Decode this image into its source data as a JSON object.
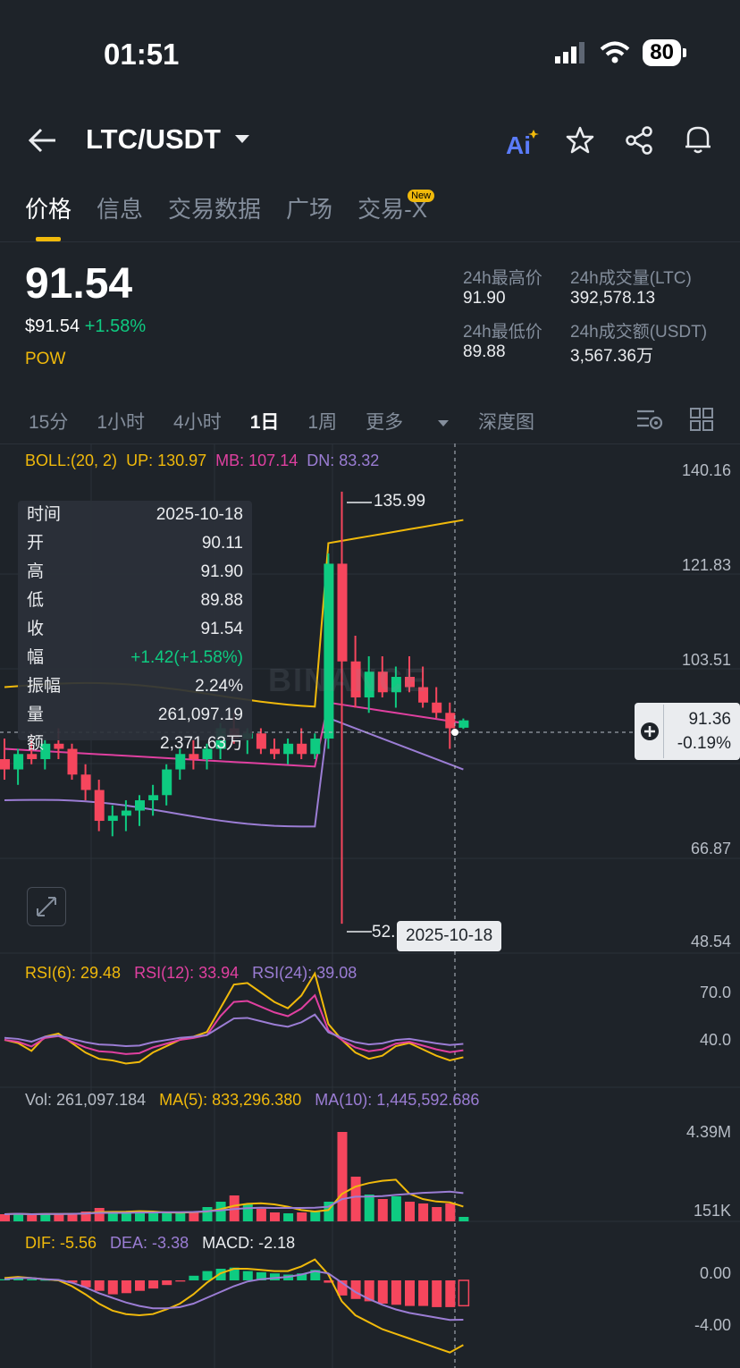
{
  "status": {
    "time": "01:51",
    "battery": "80"
  },
  "header": {
    "pair": "LTC/USDT"
  },
  "tabs": [
    {
      "label": "价格"
    },
    {
      "label": "信息"
    },
    {
      "label": "交易数据"
    },
    {
      "label": "广场"
    },
    {
      "label": "交易-X"
    }
  ],
  "new_badge": "New",
  "price": {
    "last": "91.54",
    "usd": "$91.54",
    "change": "+1.58%",
    "tag": "POW"
  },
  "stats": {
    "high_label": "24h最高价",
    "high_value": "91.90",
    "low_label": "24h最低价",
    "low_value": "89.88",
    "vol_label": "24h成交量(LTC)",
    "vol_value": "392,578.13",
    "amt_label": "24h成交额(USDT)",
    "amt_value": "3,567.36万"
  },
  "intervals": [
    "15分",
    "1小时",
    "4小时",
    "1日",
    "1周",
    "更多"
  ],
  "depth": "深度图",
  "boll": {
    "label": "BOLL:(20, 2)",
    "up": "UP: 130.97",
    "mb": "MB: 107.14",
    "dn": "DN: 83.32"
  },
  "price_axis": [
    "140.16",
    "121.83",
    "103.51",
    "66.87",
    "48.54"
  ],
  "max_label": "135.99",
  "min_label": "52.",
  "tooltip": [
    {
      "k": "时间",
      "v": "2025-10-18"
    },
    {
      "k": "开",
      "v": "90.11"
    },
    {
      "k": "高",
      "v": "91.90"
    },
    {
      "k": "低",
      "v": "89.88"
    },
    {
      "k": "收",
      "v": "91.54"
    },
    {
      "k": "幅",
      "v": "+1.42(+1.58%)"
    },
    {
      "k": "振幅",
      "v": "2.24%"
    },
    {
      "k": "量",
      "v": "261,097.19"
    },
    {
      "k": "额",
      "v": "2,371.63万"
    }
  ],
  "crosshair": {
    "price": "91.36",
    "pct": "-0.19%",
    "date": "2025-10-18"
  },
  "watermark": "BINANCE",
  "rsi": {
    "r6": "RSI(6): 29.48",
    "r12": "RSI(12): 33.94",
    "r24": "RSI(24): 39.08",
    "axis_hi": "70.0",
    "axis_lo": "40.0"
  },
  "vol": {
    "v": "Vol: 261,097.184",
    "ma5": "MA(5): 833,296.380",
    "ma10": "MA(10): 1,445,592.686",
    "axis_hi": "4.39M",
    "axis_lo": "151K"
  },
  "macd": {
    "dif": "DIF: -5.56",
    "dea": "DEA: -3.38",
    "macd": "MACD: -2.18",
    "axis_hi": "0.00",
    "axis_lo": "-4.00"
  },
  "colors": {
    "up": "#0ecb81",
    "down": "#f6465d",
    "accent": "#f0b90b",
    "mb": "#e040a0",
    "dn": "#9b7dd4"
  },
  "chart_data": {
    "type": "candlestick",
    "candles": [
      {
        "o": 84,
        "h": 88,
        "l": 80,
        "c": 82
      },
      {
        "o": 82,
        "h": 86,
        "l": 79,
        "c": 85
      },
      {
        "o": 85,
        "h": 89,
        "l": 83,
        "c": 84
      },
      {
        "o": 84,
        "h": 88,
        "l": 82,
        "c": 87
      },
      {
        "o": 87,
        "h": 90,
        "l": 84,
        "c": 86
      },
      {
        "o": 86,
        "h": 87,
        "l": 80,
        "c": 81
      },
      {
        "o": 81,
        "h": 83,
        "l": 76,
        "c": 78
      },
      {
        "o": 78,
        "h": 80,
        "l": 70,
        "c": 72
      },
      {
        "o": 72,
        "h": 75,
        "l": 69,
        "c": 73
      },
      {
        "o": 73,
        "h": 76,
        "l": 70,
        "c": 74
      },
      {
        "o": 74,
        "h": 77,
        "l": 71,
        "c": 76
      },
      {
        "o": 76,
        "h": 79,
        "l": 73,
        "c": 77
      },
      {
        "o": 77,
        "h": 83,
        "l": 75,
        "c": 82
      },
      {
        "o": 82,
        "h": 86,
        "l": 80,
        "c": 85
      },
      {
        "o": 85,
        "h": 88,
        "l": 82,
        "c": 84
      },
      {
        "o": 84,
        "h": 87,
        "l": 82,
        "c": 86
      },
      {
        "o": 86,
        "h": 91,
        "l": 84,
        "c": 90
      },
      {
        "o": 90,
        "h": 93,
        "l": 87,
        "c": 88
      },
      {
        "o": 88,
        "h": 90,
        "l": 85,
        "c": 89
      },
      {
        "o": 89,
        "h": 90,
        "l": 85,
        "c": 86
      },
      {
        "o": 86,
        "h": 88,
        "l": 84,
        "c": 85
      },
      {
        "o": 85,
        "h": 88,
        "l": 83,
        "c": 87
      },
      {
        "o": 87,
        "h": 90,
        "l": 84,
        "c": 85
      },
      {
        "o": 85,
        "h": 89,
        "l": 84,
        "c": 88
      },
      {
        "o": 88,
        "h": 124,
        "l": 86,
        "c": 122
      },
      {
        "o": 122,
        "h": 136,
        "l": 52,
        "c": 103
      },
      {
        "o": 103,
        "h": 108,
        "l": 94,
        "c": 96
      },
      {
        "o": 96,
        "h": 104,
        "l": 93,
        "c": 101
      },
      {
        "o": 101,
        "h": 104,
        "l": 96,
        "c": 97
      },
      {
        "o": 97,
        "h": 102,
        "l": 94,
        "c": 100
      },
      {
        "o": 100,
        "h": 104,
        "l": 97,
        "c": 98
      },
      {
        "o": 98,
        "h": 102,
        "l": 94,
        "c": 95
      },
      {
        "o": 95,
        "h": 98,
        "l": 92,
        "c": 93
      },
      {
        "o": 93,
        "h": 95,
        "l": 86,
        "c": 90
      },
      {
        "o": 90.11,
        "h": 91.9,
        "l": 89.88,
        "c": 91.54
      }
    ]
  }
}
